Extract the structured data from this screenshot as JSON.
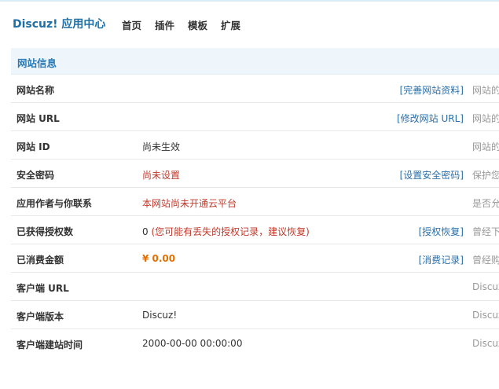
{
  "header": {
    "brand": "Discuz! 应用中心",
    "nav": [
      "首页",
      "插件",
      "模板",
      "扩展"
    ]
  },
  "section": {
    "title": "网站信息"
  },
  "rows": [
    {
      "label": "网站名称",
      "value": "",
      "action": "[完善网站资料]",
      "desc": "网站的"
    },
    {
      "label": "网站 URL",
      "value": "",
      "action": "[修改网站 URL]",
      "desc": "网站的"
    },
    {
      "label": "网站 ID",
      "value": "尚未生效",
      "action": "",
      "desc": "网站的"
    },
    {
      "label": "安全密码",
      "value": "尚未设置",
      "action": "[设置安全密码]",
      "desc": "保护您"
    },
    {
      "label": "应用作者与你联系",
      "value": "本网站尚未开通云平台",
      "action": "",
      "desc": "是否允"
    },
    {
      "label": "已获得授权数",
      "value_num": "0",
      "value_note": " (您可能有丢失的授权记录，建议恢复)",
      "action": "[授权恢复]",
      "desc": "曾经下"
    },
    {
      "label": "已消费金额",
      "value": "¥ 0.00",
      "action": "[消费记录]",
      "desc": "曾经购"
    },
    {
      "label": "客户端 URL",
      "value": "",
      "action": "",
      "desc": "Discuz"
    },
    {
      "label": "客户端版本",
      "value": "Discuz!",
      "action": "",
      "desc": "Discuz"
    },
    {
      "label": "客户端建站时间",
      "value": "2000-00-00 00:00:00",
      "action": "",
      "desc": "Discuz"
    }
  ]
}
